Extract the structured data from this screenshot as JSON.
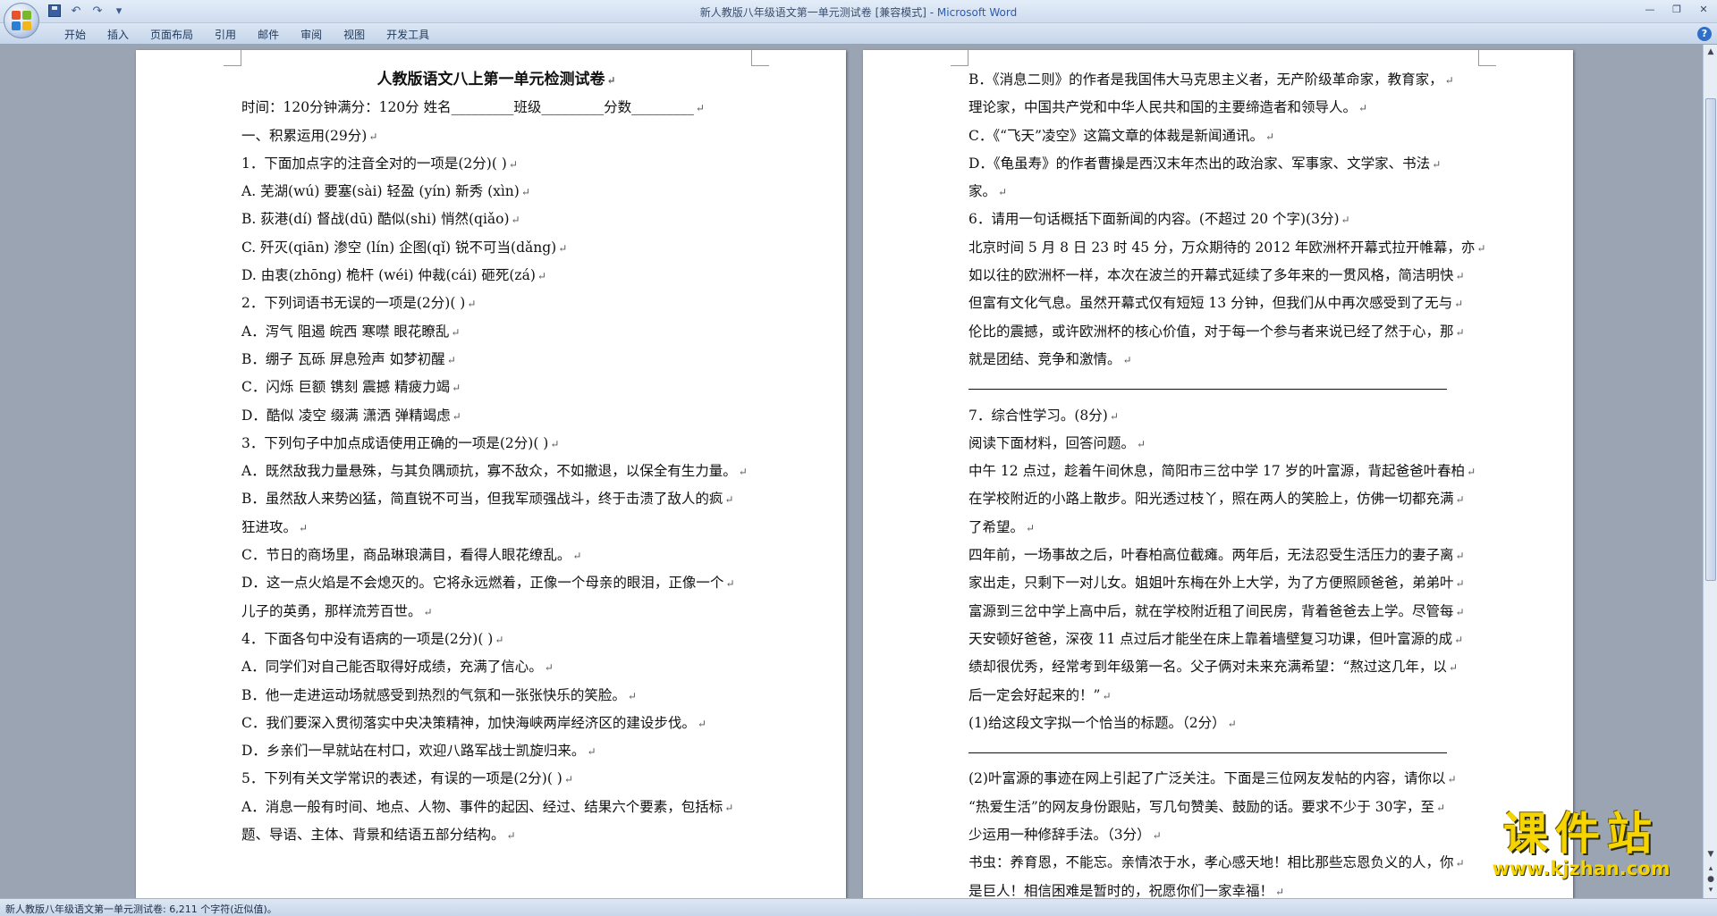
{
  "window": {
    "title_doc": "新人教版八年级语文第一单元测试卷 [兼容模式] - ",
    "title_app": "Microsoft Word"
  },
  "ribbon": {
    "tabs": [
      "开始",
      "插入",
      "页面布局",
      "引用",
      "邮件",
      "审阅",
      "视图",
      "开发工具"
    ]
  },
  "page_left": {
    "title": "人教版语文八上第一单元检测试卷",
    "lines": [
      "时间：120分钟满分：120分   姓名_________班级_________分数_________",
      "一、积累运用(29分)",
      "1．下面加点字的注音全对的一项是(2分)(      )",
      "A. 芜湖(wú)      要塞(sài)     轻盈 (yín)     新秀 (xìn)",
      "B. 荻港(dí)       督战(dū)      酷似(shi)     悄然(qiǎo)",
      "C. 歼灭(qiān)     渗空 (lín)     企图(qǐ)      锐不可当(dǎng)",
      "D. 由衷(zhōng)     桅杆 (wéi)     仲裁(cái)      砸死(zá)",
      "2．下列词语书无误的一项是(2分)(      )",
      "A．泻气   阻遏   皖西   寒噤      眼花瞭乱",
      "B．绷子   瓦砾      屏息殓声      如梦初醒",
      "C．闪烁   巨额   镌刻   震撼      精疲力竭",
      "D．酷似   凌空   缀满   潇洒      弹精竭虑",
      "3．下列句子中加点成语使用正确的一项是(2分)(     )",
      "A．既然敌我力量悬殊，与其负隅顽抗，寡不敌众，不如撤退，以保全有生力量。",
      "B．虽然敌人来势凶猛，简直锐不可当，但我军顽强战斗，终于击溃了敌人的疯",
      "狂进攻。",
      "C．节日的商场里，商品琳琅满目，看得人眼花缭乱。",
      "D．这一点火焰是不会熄灭的。它将永远燃着，正像一个母亲的眼泪，正像一个",
      "儿子的英勇，那样流芳百世。",
      "4．下面各句中没有语病的一项是(2分)(      )",
      "A．同学们对自己能否取得好成绩，充满了信心。",
      "B．他一走进运动场就感受到热烈的气氛和一张张快乐的笑脸。",
      "C．我们要深入贯彻落实中央决策精神，加快海峡两岸经济区的建设步伐。",
      "D．乡亲们一早就站在村口，欢迎八路军战士凯旋归来。",
      "5．下列有关文学常识的表述，有误的一项是(2分)(      )",
      "A．消息一般有时间、地点、人物、事件的起因、经过、结果六个要素，包括标",
      "题、导语、主体、背景和结语五部分结构。"
    ]
  },
  "page_right": {
    "lines": [
      "B．《消息二则》的作者是我国伟大马克思主义者，无产阶级革命家，教育家，",
      "理论家，中国共产党和中华人民共和国的主要缔造者和领导人。",
      "C．《“飞天”凌空》这篇文章的体裁是新闻通讯。",
      "D．《龟虽寿》的作者曹操是西汉末年杰出的政治家、军事家、文学家、书法",
      "家。",
      "6．请用一句话概括下面新闻的内容。(不超过 20 个字)(3分)",
      "北京时间 5 月 8 日 23 时 45 分，万众期待的 2012 年欧洲杯开幕式拉开帷幕，亦",
      "如以往的欧洲杯一样，本次在波兰的开幕式延续了多年来的一贯风格，简洁明快",
      "但富有文化气息。虽然开幕式仅有短短 13 分钟，但我们从中再次感受到了无与",
      "伦比的震撼，或许欧洲杯的核心价值，对于每一个参与者来说已经了然于心，那",
      "就是团结、竞争和激情。",
      "",
      "7．综合性学习。(8分)",
      "阅读下面材料，回答问题。",
      "中午 12 点过，趁着午间休息，简阳市三岔中学 17 岁的叶富源，背起爸爸叶春柏",
      "在学校附近的小路上散步。阳光透过枝丫，照在两人的笑脸上，仿佛一切都充满",
      "了希望。",
      "四年前，一场事故之后，叶春柏高位截瘫。两年后，无法忍受生活压力的妻子离",
      "家出走，只剩下一对儿女。姐姐叶东梅在外上大学，为了方便照顾爸爸，弟弟叶",
      "富源到三岔中学上高中后，就在学校附近租了间民房，背着爸爸去上学。尽管每",
      "天安顿好爸爸，深夜 11 点过后才能坐在床上靠着墙壁复习功课，但叶富源的成",
      "绩却很优秀，经常考到年级第一名。父子俩对未来充满希望：“熬过这几年，以",
      "后一定会好起来的！”",
      "(1)给这段文字拟一个恰当的标题。（2分）",
      "",
      "(2)叶富源的事迹在网上引起了广泛关注。下面是三位网友发帖的内容，请你以",
      "“热爱生活”的网友身份跟贴，写几句赞美、鼓励的话。要求不少于 30字，至",
      "少运用一种修辞手法。（3分）",
      "书虫：养育恩，不能忘。亲情浓于水，孝心感天地！相比那些忘恩负义的人，你",
      "是巨人！相信困难是暂时的，祝愿你们一家幸福！"
    ]
  },
  "statusbar": {
    "text": "新人教版八年级语文第一单元测试卷: 6,211 个字符(近似值)。"
  },
  "watermark": {
    "line1": "课件站",
    "line2": "www.kjzhan.com"
  },
  "colors": {
    "accent": "#2a5bb5",
    "watermark": "#f5d400"
  }
}
